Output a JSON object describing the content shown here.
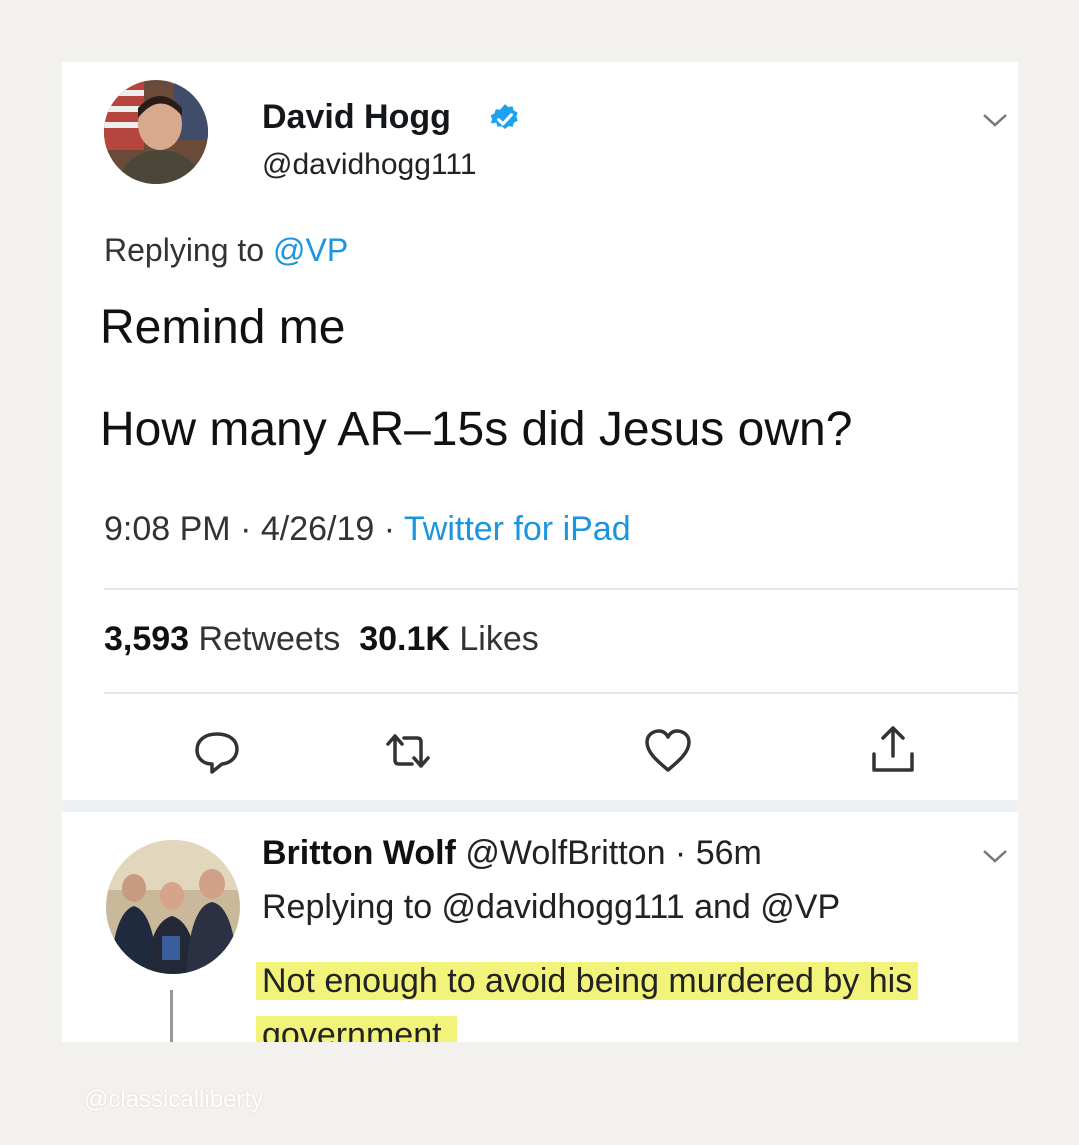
{
  "tweet": {
    "author_name": "David Hogg",
    "author_handle": "@davidhogg111",
    "replying_prefix": "Replying to ",
    "replying_mention": "@VP",
    "line1": "Remind me",
    "line2": "How many AR–15s did Jesus own?",
    "time": "9:08 PM · 4/26/19 · ",
    "source": "Twitter for iPad",
    "retweets_count": "3,593",
    "retweets_label": " Retweets",
    "likes_count": "30.1K",
    "likes_label": " Likes",
    "verified_icon": "verified-badge-icon",
    "actions": [
      "reply-icon",
      "retweet-icon",
      "like-icon",
      "share-icon"
    ]
  },
  "reply": {
    "author_name": "Britton Wolf",
    "author_handle_time": " @WolfBritton · 56m",
    "replying_line": "Replying to @davidhogg111 and @VP",
    "text": "Not enough to avoid being murdered by his government."
  },
  "watermark": "@classicalliberty",
  "colors": {
    "link_blue": "#1b95e0",
    "highlight_yellow": "#f2f37a",
    "verified_blue": "#1da1f2"
  }
}
